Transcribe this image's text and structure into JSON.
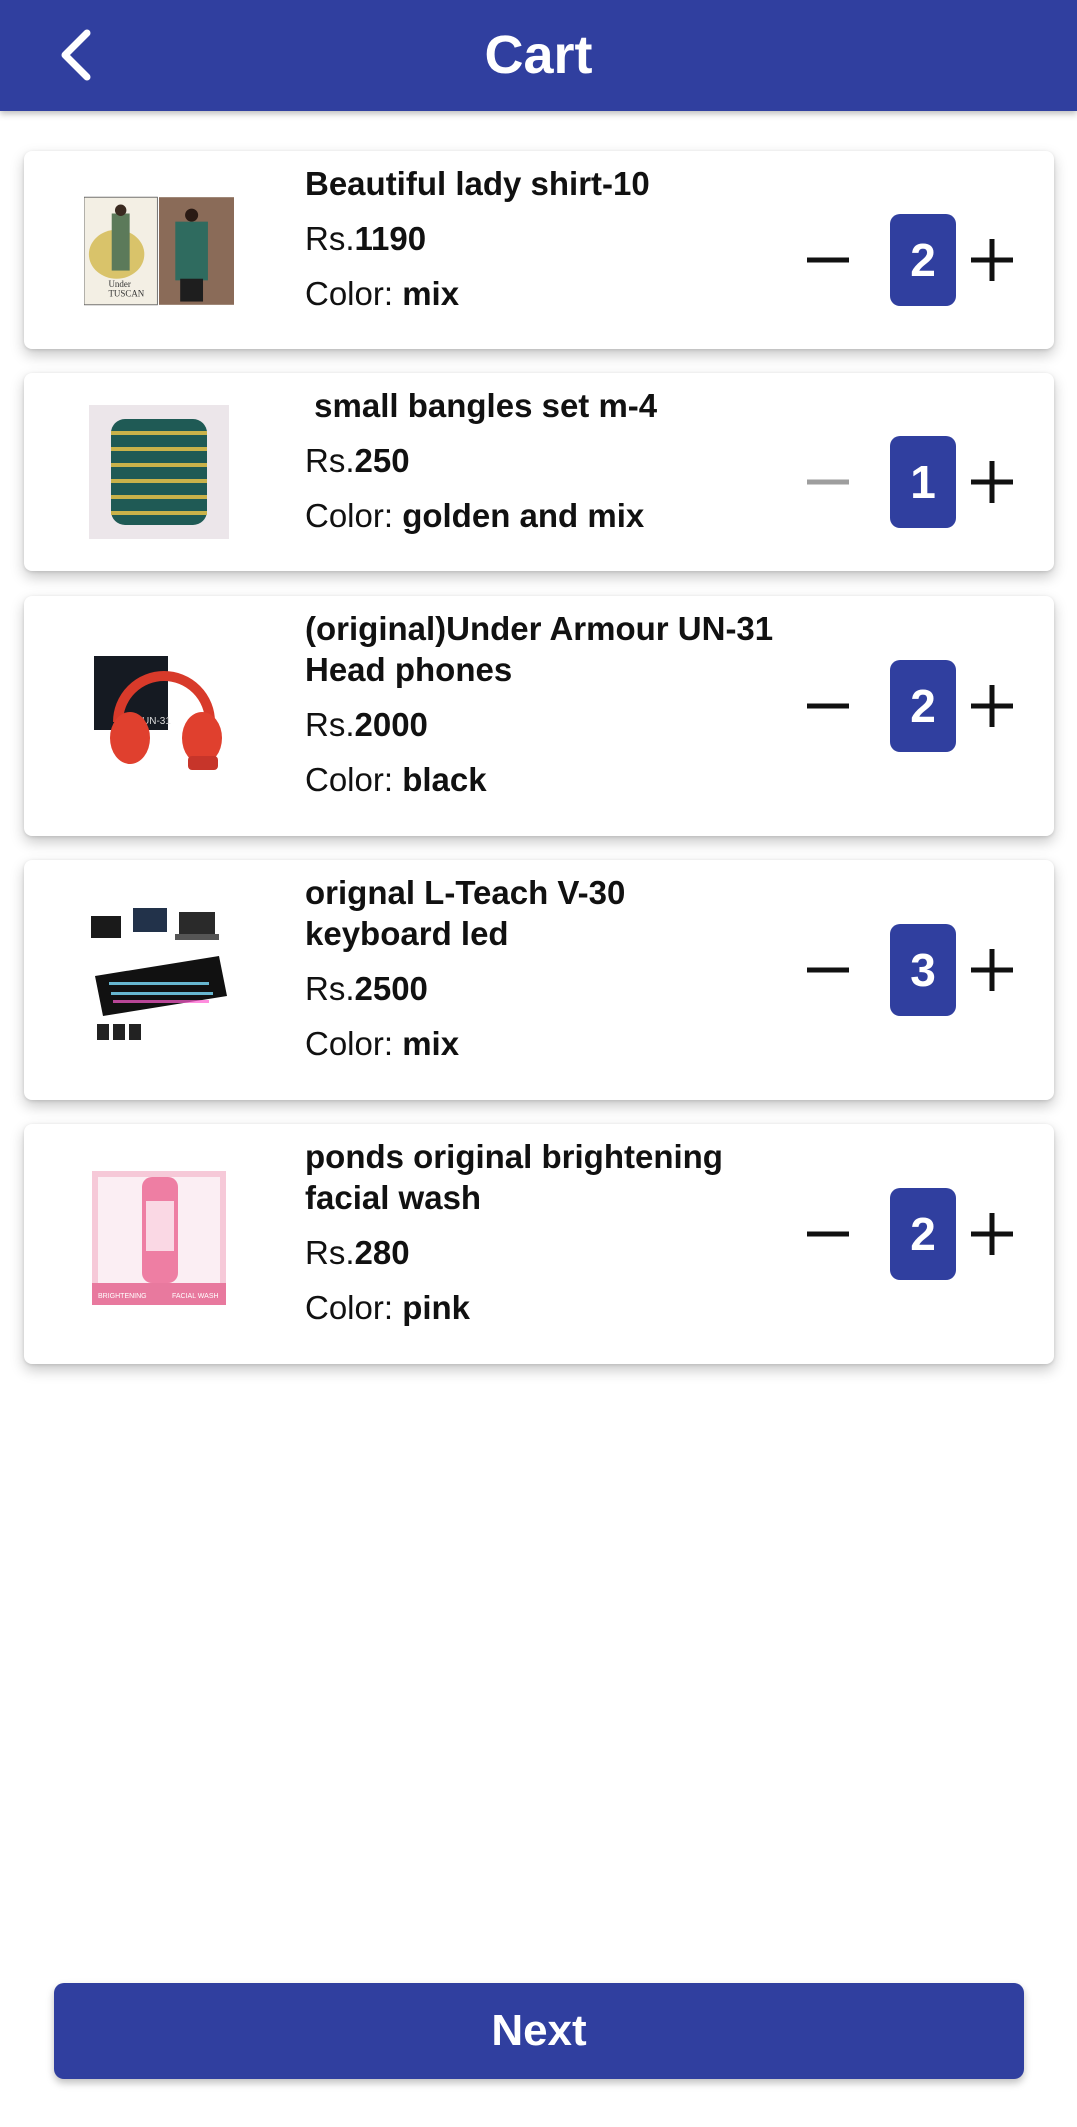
{
  "header": {
    "title": "Cart",
    "back_icon": "chevron-left-icon"
  },
  "cart": {
    "items": [
      {
        "name": "Beautiful lady shirt-10",
        "price_prefix": "Rs.",
        "price": "1190",
        "color_label": "Color: ",
        "color": "mix",
        "quantity": "2",
        "minus_enabled": true,
        "thumbnail": "lady-shirt-image"
      },
      {
        "name": " small bangles set m-4",
        "price_prefix": "Rs.",
        "price": "250",
        "color_label": "Color: ",
        "color": "golden and mix",
        "quantity": "1",
        "minus_enabled": false,
        "thumbnail": "bangles-image"
      },
      {
        "name": "(original)Under Armour UN-31 Head phones",
        "price_prefix": "Rs.",
        "price": "2000",
        "color_label": "Color: ",
        "color": "black",
        "quantity": "2",
        "minus_enabled": true,
        "thumbnail": "headphones-image"
      },
      {
        "name": "orignal L-Teach V-30 keyboard led",
        "price_prefix": "Rs.",
        "price": "2500",
        "color_label": "Color: ",
        "color": "mix",
        "quantity": "3",
        "minus_enabled": true,
        "thumbnail": "keyboard-image"
      },
      {
        "name": "ponds original brightening facial wash",
        "price_prefix": "Rs.",
        "price": "280",
        "color_label": "Color: ",
        "color": "pink",
        "quantity": "2",
        "minus_enabled": true,
        "thumbnail": "facial-wash-image"
      }
    ]
  },
  "footer": {
    "next_label": "Next"
  },
  "colors": {
    "primary": "#303f9f",
    "disabled": "#9e9e9e",
    "text": "#111111"
  }
}
